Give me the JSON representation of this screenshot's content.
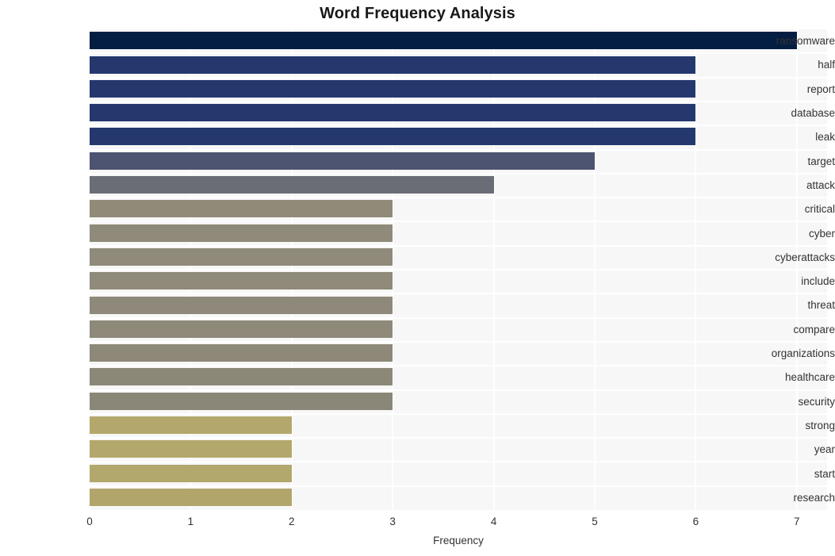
{
  "chart_data": {
    "type": "bar",
    "orientation": "horizontal",
    "title": "Word Frequency Analysis",
    "xlabel": "Frequency",
    "ylabel": "",
    "xlim": [
      0,
      7.3
    ],
    "ylim": [
      0,
      20
    ],
    "xticks": [
      "0",
      "1",
      "2",
      "3",
      "4",
      "5",
      "6",
      "7"
    ],
    "xtick_values": [
      0,
      1,
      2,
      3,
      4,
      5,
      6,
      7
    ],
    "grid": true,
    "legend": "none",
    "background": "#f7f7f7",
    "gridline_color": "#ffffff",
    "categories": [
      "ransomware",
      "half",
      "report",
      "database",
      "leak",
      "target",
      "attack",
      "critical",
      "cyber",
      "cyberattacks",
      "include",
      "threat",
      "compare",
      "organizations",
      "healthcare",
      "security",
      "strong",
      "year",
      "start",
      "research"
    ],
    "values": [
      7,
      6,
      6,
      6,
      6,
      5,
      4,
      3,
      3,
      3,
      3,
      3,
      3,
      3,
      3,
      3,
      2,
      2,
      2,
      2
    ],
    "bar_colors": [
      "#041e42",
      "#25386e",
      "#25386e",
      "#25386e",
      "#25386e",
      "#4d5471",
      "#6a6d75",
      "#908a79",
      "#8f8a79",
      "#8f8a79",
      "#8f8a79",
      "#8e897a",
      "#8e8979",
      "#8d8878",
      "#8c8878",
      "#8b8778",
      "#b3a76c",
      "#b3a76c",
      "#b2a76c",
      "#b1a56b"
    ]
  }
}
